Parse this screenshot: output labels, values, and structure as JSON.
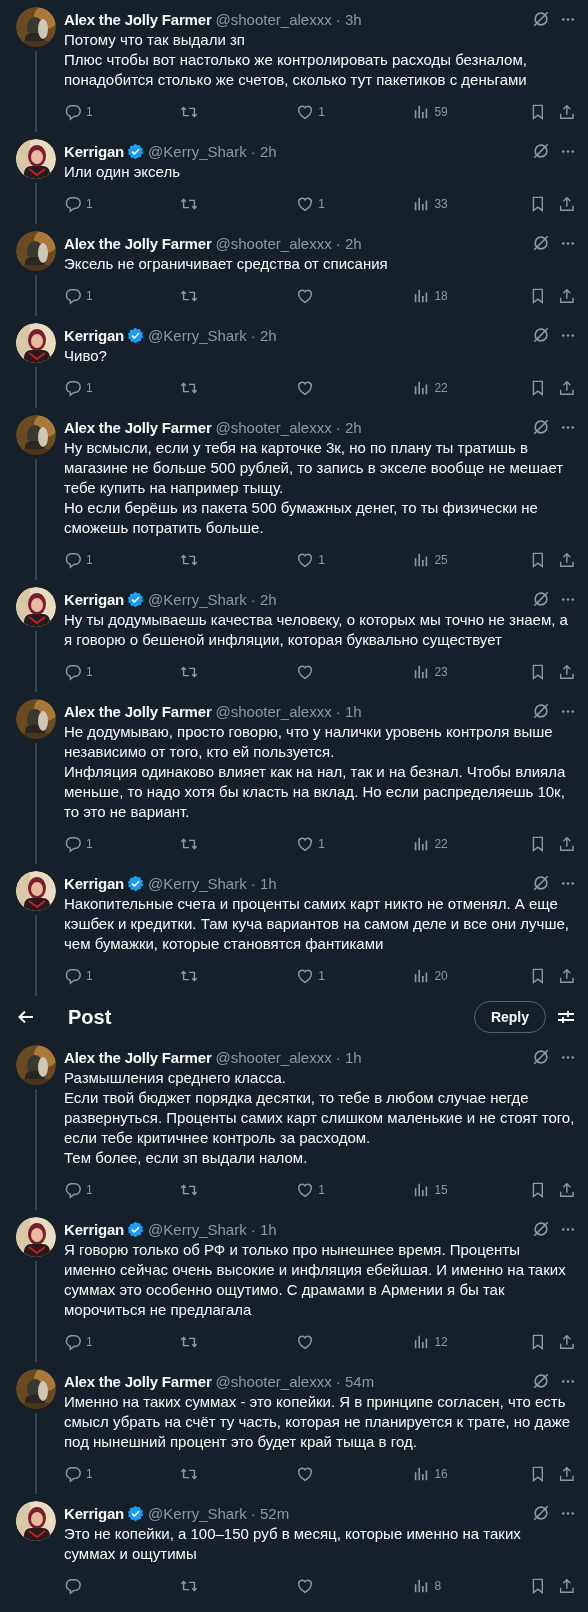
{
  "thread": [
    {
      "name": "Alex the Jolly Farmer",
      "verified": false,
      "meta": "@shooter_alexxx · 3h",
      "text": "Потому что так выдали зп\nПлюс чтобы вот настолько же контролировать расходы безналом, понадобится столько же счетов, сколько тут пакетиков с деньгами",
      "replies": "1",
      "likes": "1",
      "views": "59"
    },
    {
      "name": "Kerrigan",
      "verified": true,
      "meta": "@Kerry_Shark · 2h",
      "text": "Или один эксель",
      "replies": "1",
      "likes": "1",
      "views": "33"
    },
    {
      "name": "Alex the Jolly Farmer",
      "verified": false,
      "meta": "@shooter_alexxx · 2h",
      "text": "Эксель не ограничивает средства от списания",
      "replies": "1",
      "views": "18"
    },
    {
      "name": "Kerrigan",
      "verified": true,
      "meta": "@Kerry_Shark · 2h",
      "text": "Чиво?",
      "replies": "1",
      "views": "22"
    },
    {
      "name": "Alex the Jolly Farmer",
      "verified": false,
      "meta": "@shooter_alexxx · 2h",
      "text": "Ну всмысли, если у тебя на карточке 3к, но по плану ты тратишь в магазине не больше 500 рублей, то запись в экселе вообще не мешает тебе купить на например тыщу.\nНо если берёшь из пакета 500 бумажных денег, то ты физически не сможешь потратить больше.",
      "replies": "1",
      "likes": "1",
      "views": "25"
    },
    {
      "name": "Kerrigan",
      "verified": true,
      "meta": "@Kerry_Shark · 2h",
      "text": "Ну ты додумываешь качества человеку, о которых мы точно не знаем, а я говорю о бешеной инфляции, которая буквально существует",
      "replies": "1",
      "views": "23"
    },
    {
      "name": "Alex the Jolly Farmer",
      "verified": false,
      "meta": "@shooter_alexxx · 1h",
      "text": "Не додумываю, просто говорю, что у налички уровень контроля выше независимо от того, кто ей пользуется.\nИнфляция одинаково влияет как на нал, так и на безнал. Чтобы влияла меньше, то надо хотя бы класть на вклад. Но если распределяешь 10к, то это не вариант.",
      "replies": "1",
      "likes": "1",
      "views": "22"
    },
    {
      "name": "Kerrigan",
      "verified": true,
      "meta": "@Kerry_Shark · 1h",
      "text": "Накопительные счета и проценты самих карт никто не отменял. А еще кэшбек и кредитки. Там куча вариантов на самом деле и все они лучше, чем бумажки, которые становятся фантиками",
      "replies": "1",
      "likes": "1",
      "views": "20"
    },
    {
      "name": "Alex the Jolly Farmer",
      "verified": false,
      "meta": "@shooter_alexxx · 1h",
      "text": "Размышления среднего класса.\nЕсли твой бюджет порядка десятки, то тебе в любом случае негде развернуться. Проценты самих карт слишком маленькие и не стоят того, если тебе критичнее контроль за расходом.\nТем более, если зп выдали налом.",
      "replies": "1",
      "likes": "1",
      "views": "15"
    },
    {
      "name": "Kerrigan",
      "verified": true,
      "meta": "@Kerry_Shark · 1h",
      "text": "Я говорю только об РФ и только про нынешнее время. Проценты именно сейчас очень высокие и инфляция ебейшая. И именно на таких суммах это особенно ощутимо. С драмами в Армении я бы так морочиться не предлагала",
      "replies": "1",
      "views": "12"
    },
    {
      "name": "Alex the Jolly Farmer",
      "verified": false,
      "meta": "@shooter_alexxx · 54m",
      "text": "Именно на таких суммах - это копейки. Я в принципе согласен, что есть смысл убрать на счёт ту часть, которая не планируется к трате, но даже под нынешний процент это будет край тыща в год.",
      "replies": "1",
      "views": "16"
    },
    {
      "name": "Kerrigan",
      "verified": true,
      "meta": "@Kerry_Shark · 52m",
      "text": "Это не копейки, а 100–150 руб в месяц, которые именно на таких суммах и ощутимы",
      "views": "8"
    }
  ],
  "header": {
    "title": "Post",
    "reply_button": "Reply"
  }
}
